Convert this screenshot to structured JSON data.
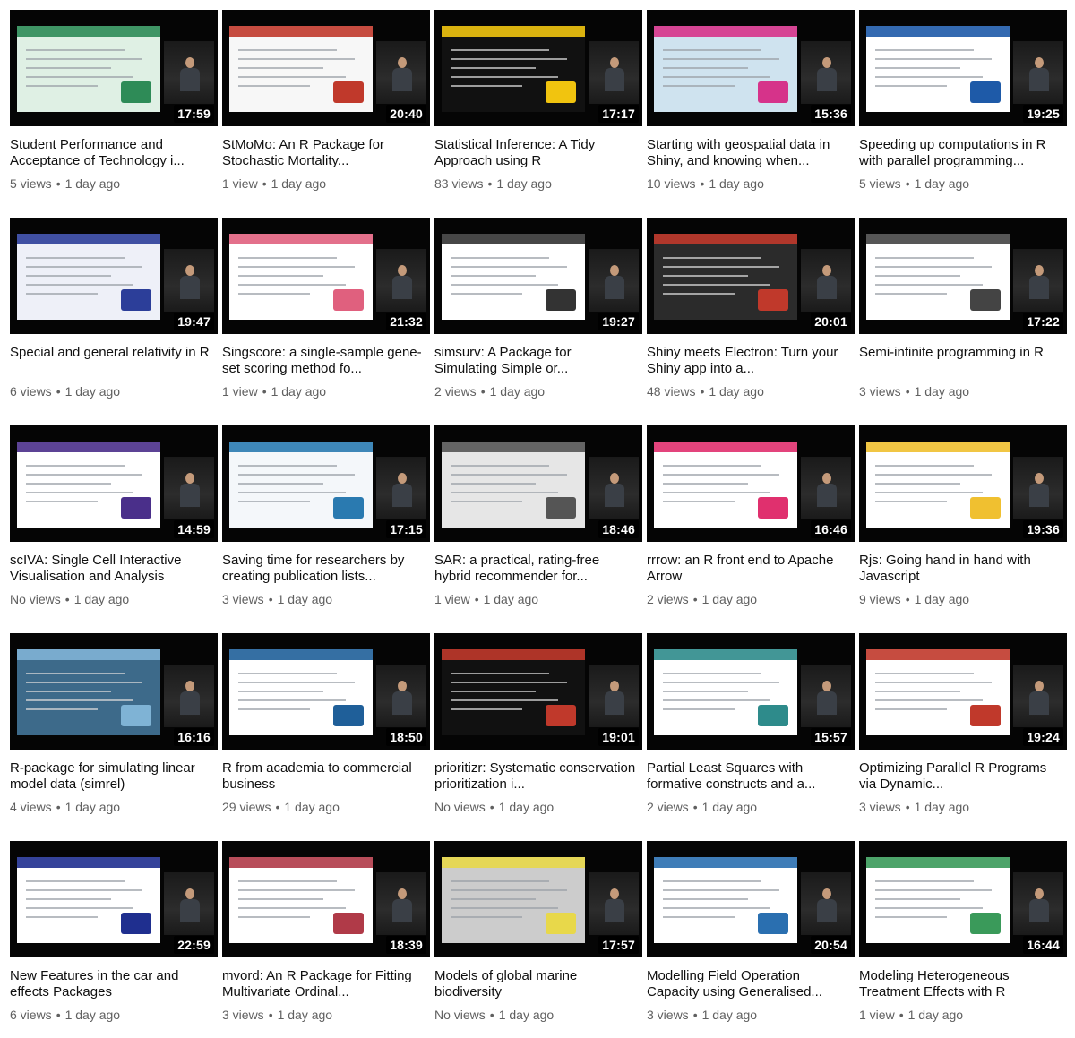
{
  "meta_separator": "•",
  "videos": [
    {
      "title": "Student Performance and Acceptance of Technology i...",
      "duration": "17:59",
      "views": "5 views",
      "age": "1 day ago",
      "slide_bg": "#dff0e4",
      "slide_accent": "#2e8b57"
    },
    {
      "title": "StMoMo: An R Package for Stochastic Mortality...",
      "duration": "20:40",
      "views": "1 view",
      "age": "1 day ago",
      "slide_bg": "#f7f7f7",
      "slide_accent": "#c0392b"
    },
    {
      "title": "Statistical Inference: A Tidy Approach using R",
      "duration": "17:17",
      "views": "83 views",
      "age": "1 day ago",
      "slide_bg": "#111111",
      "slide_accent": "#f1c40f"
    },
    {
      "title": "Starting with geospatial data in Shiny, and knowing when...",
      "duration": "15:36",
      "views": "10 views",
      "age": "1 day ago",
      "slide_bg": "#cfe3ef",
      "slide_accent": "#d6338a"
    },
    {
      "title": "Speeding up computations in R with parallel programming...",
      "duration": "19:25",
      "views": "5 views",
      "age": "1 day ago",
      "slide_bg": "#ffffff",
      "slide_accent": "#1e5aa8"
    },
    {
      "title": "Special and general relativity in R",
      "duration": "19:47",
      "views": "6 views",
      "age": "1 day ago",
      "slide_bg": "#eef0f8",
      "slide_accent": "#2c3e99"
    },
    {
      "title": "Singscore: a single-sample gene-set scoring method fo...",
      "duration": "21:32",
      "views": "1 view",
      "age": "1 day ago",
      "slide_bg": "#ffffff",
      "slide_accent": "#e0607e"
    },
    {
      "title": "simsurv: A Package for Simulating Simple or...",
      "duration": "19:27",
      "views": "2 views",
      "age": "1 day ago",
      "slide_bg": "#ffffff",
      "slide_accent": "#333333"
    },
    {
      "title": "Shiny meets Electron: Turn your Shiny app into a...",
      "duration": "20:01",
      "views": "48 views",
      "age": "1 day ago",
      "slide_bg": "#2b2b2b",
      "slide_accent": "#c0392b"
    },
    {
      "title": "Semi-infinite programming in R",
      "duration": "17:22",
      "views": "3 views",
      "age": "1 day ago",
      "slide_bg": "#ffffff",
      "slide_accent": "#444444"
    },
    {
      "title": "scIVA: Single Cell Interactive Visualisation and Analysis",
      "duration": "14:59",
      "views": "No views",
      "age": "1 day ago",
      "slide_bg": "#ffffff",
      "slide_accent": "#4a2f8a"
    },
    {
      "title": "Saving time for researchers by creating publication lists...",
      "duration": "17:15",
      "views": "3 views",
      "age": "1 day ago",
      "slide_bg": "#f4f7fa",
      "slide_accent": "#2a7ab0"
    },
    {
      "title": "SAR: a practical, rating-free hybrid recommender for...",
      "duration": "18:46",
      "views": "1 view",
      "age": "1 day ago",
      "slide_bg": "#e6e6e6",
      "slide_accent": "#555555"
    },
    {
      "title": "rrrow: an R front end to Apache Arrow",
      "duration": "16:46",
      "views": "2 views",
      "age": "1 day ago",
      "slide_bg": "#ffffff",
      "slide_accent": "#e0306e"
    },
    {
      "title": "Rjs: Going hand in hand with Javascript",
      "duration": "19:36",
      "views": "9 views",
      "age": "1 day ago",
      "slide_bg": "#ffffff",
      "slide_accent": "#f0c030"
    },
    {
      "title": "R-package for simulating linear model data (simrel)",
      "duration": "16:16",
      "views": "4 views",
      "age": "1 day ago",
      "slide_bg": "#3d6a8a",
      "slide_accent": "#7fb3d5"
    },
    {
      "title": "R from academia to commercial business",
      "duration": "18:50",
      "views": "29 views",
      "age": "1 day ago",
      "slide_bg": "#ffffff",
      "slide_accent": "#1f5f99"
    },
    {
      "title": "prioritizr: Systematic conservation prioritization i...",
      "duration": "19:01",
      "views": "No views",
      "age": "1 day ago",
      "slide_bg": "#111111",
      "slide_accent": "#c0392b"
    },
    {
      "title": "Partial Least Squares with formative constructs and a...",
      "duration": "15:57",
      "views": "2 views",
      "age": "1 day ago",
      "slide_bg": "#ffffff",
      "slide_accent": "#2e8b8b"
    },
    {
      "title": "Optimizing Parallel R Programs via Dynamic...",
      "duration": "19:24",
      "views": "3 views",
      "age": "1 day ago",
      "slide_bg": "#ffffff",
      "slide_accent": "#c0392b"
    },
    {
      "title": "New Features in the car and effects Packages",
      "duration": "22:59",
      "views": "6 views",
      "age": "1 day ago",
      "slide_bg": "#ffffff",
      "slide_accent": "#1f2f8f"
    },
    {
      "title": "mvord: An R Package for Fitting Multivariate Ordinal...",
      "duration": "18:39",
      "views": "3 views",
      "age": "1 day ago",
      "slide_bg": "#ffffff",
      "slide_accent": "#b03a48"
    },
    {
      "title": "Models of global marine biodiversity",
      "duration": "17:57",
      "views": "No views",
      "age": "1 day ago",
      "slide_bg": "#cccccc",
      "slide_accent": "#e8d84a"
    },
    {
      "title": "Modelling Field Operation Capacity using Generalised...",
      "duration": "20:54",
      "views": "3 views",
      "age": "1 day ago",
      "slide_bg": "#ffffff",
      "slide_accent": "#2a6fb0"
    },
    {
      "title": "Modeling Heterogeneous Treatment Effects with R",
      "duration": "16:44",
      "views": "1 view",
      "age": "1 day ago",
      "slide_bg": "#ffffff",
      "slide_accent": "#3a9a5a"
    }
  ]
}
